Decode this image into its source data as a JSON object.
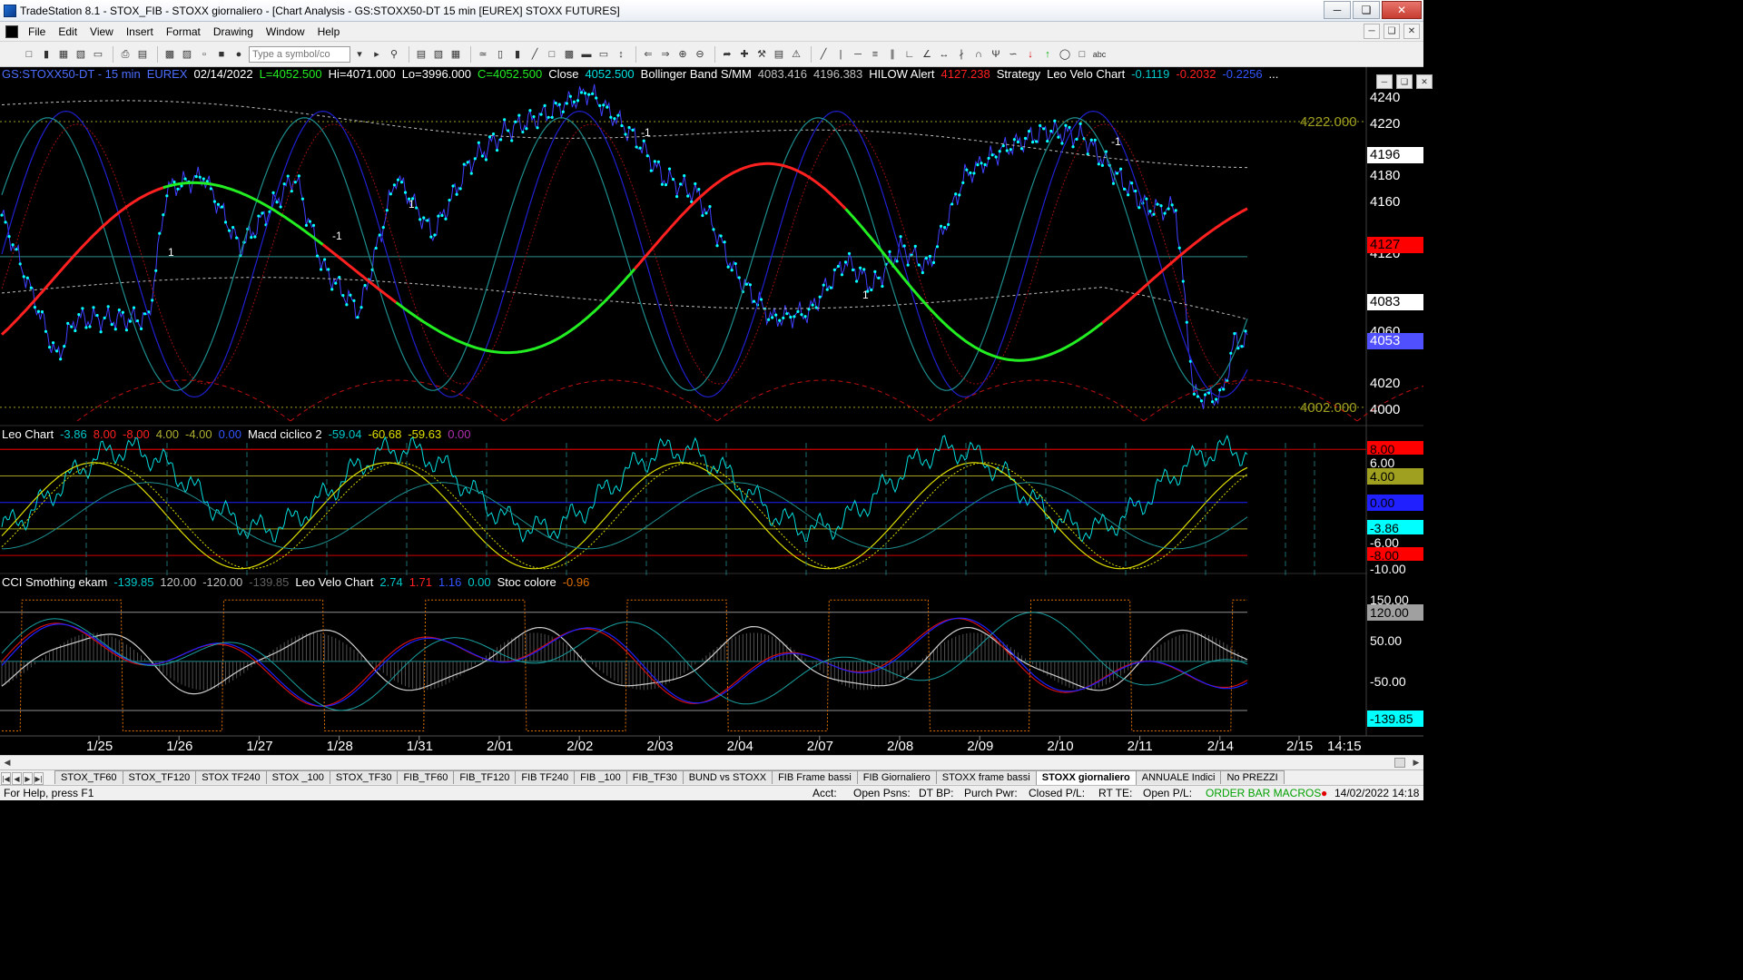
{
  "window": {
    "title": "TradeStation 8.1 - STOX_FIB - STOXX giornaliero - [Chart Analysis - GS:STOXX50-DT  15 min  [EUREX] STOXX FUTURES]",
    "buttons": [
      "─",
      "❏",
      "✕"
    ]
  },
  "menu": [
    "File",
    "Edit",
    "View",
    "Insert",
    "Format",
    "Drawing",
    "Window",
    "Help"
  ],
  "toolbar": {
    "symbol_placeholder": "Type a symbol/co"
  },
  "colors": {
    "background": "#000000",
    "cyan": "#00ffff",
    "red": "#ff0000",
    "green": "#22ee22",
    "yellow": "#dddd00",
    "blue": "#3333ff",
    "olive": "#a0a020"
  },
  "panes": {
    "price": {
      "header": [
        {
          "text": "GS:STOXX50-DT - 15 min",
          "color": "#4d6dff"
        },
        {
          "text": "EUREX",
          "color": "#4d6dff"
        },
        {
          "text": "02/14/2022",
          "color": "#ffffff"
        },
        {
          "text": "L=4052.500",
          "color": "#22ee22"
        },
        {
          "text": "Hi=4071.000",
          "color": "#ffffff"
        },
        {
          "text": "Lo=3996.000",
          "color": "#ffffff"
        },
        {
          "text": "C=4052.500",
          "color": "#22ee22"
        },
        {
          "text": "Close",
          "color": "#ffffff"
        },
        {
          "text": "4052.500",
          "color": "#00e0e0"
        },
        {
          "text": "Bollinger Band S/MM",
          "color": "#ffffff"
        },
        {
          "text": "4083.416",
          "color": "#c0c0c0"
        },
        {
          "text": "4196.383",
          "color": "#c0c0c0"
        },
        {
          "text": "HILOW Alert",
          "color": "#ffffff"
        },
        {
          "text": "4127.238",
          "color": "#ff2020"
        },
        {
          "text": "Strategy",
          "color": "#ffffff"
        },
        {
          "text": "Leo Velo Chart",
          "color": "#ffffff"
        },
        {
          "text": "-0.1119",
          "color": "#00c8c8"
        },
        {
          "text": "-0.2032",
          "color": "#ff2020"
        },
        {
          "text": "-0.2256",
          "color": "#3355ff"
        },
        {
          "text": "...",
          "color": "#ffffff"
        }
      ],
      "axis_ticks": [
        {
          "v": 4240,
          "label": "4240"
        },
        {
          "v": 4220,
          "label": "4220"
        },
        {
          "v": 4180,
          "label": "4180"
        },
        {
          "v": 4160,
          "label": "4160"
        },
        {
          "v": 4120,
          "label": "4120"
        },
        {
          "v": 4060,
          "label": "4060"
        },
        {
          "v": 4020,
          "label": "4020"
        },
        {
          "v": 4000,
          "label": "4000"
        }
      ],
      "axis_badges": [
        {
          "v": 4196,
          "label": "4196",
          "bg": "#ffffff",
          "fg": "#000000"
        },
        {
          "v": 4127,
          "label": "4127",
          "bg": "#ff0000",
          "fg": "#000000"
        },
        {
          "v": 4083,
          "label": "4083",
          "bg": "#ffffff",
          "fg": "#000000"
        },
        {
          "v": 4053,
          "label": "4053",
          "bg": "#5050ff",
          "fg": "#ffffff"
        }
      ],
      "levels": [
        {
          "v": 4222,
          "label": "4222.000"
        },
        {
          "v": 4002,
          "label": "4002.000"
        }
      ],
      "markers": [
        "1",
        "-1"
      ]
    },
    "leo": {
      "header": [
        {
          "text": "Leo Chart",
          "color": "#ffffff"
        },
        {
          "text": "-3.86",
          "color": "#00c8c8"
        },
        {
          "text": "8.00",
          "color": "#ff2020"
        },
        {
          "text": "-8.00",
          "color": "#ff2020"
        },
        {
          "text": "4.00",
          "color": "#b0b030"
        },
        {
          "text": "-4.00",
          "color": "#b0b030"
        },
        {
          "text": "0.00",
          "color": "#3355ff"
        },
        {
          "text": "Macd ciclico 2",
          "color": "#ffffff"
        },
        {
          "text": "-59.04",
          "color": "#00c8c8"
        },
        {
          "text": "-60.68",
          "color": "#e0e000"
        },
        {
          "text": "-59.63",
          "color": "#e0e000"
        },
        {
          "text": "0.00",
          "color": "#b030b0"
        }
      ],
      "axis_badges": [
        {
          "v": 8,
          "label": "8.00",
          "bg": "#ff0000",
          "fg": "#000000"
        },
        {
          "v": 6,
          "label": "6.00",
          "bg": "#000000",
          "fg": "#ffffff"
        },
        {
          "v": 4,
          "label": "4.00",
          "bg": "#a0a020",
          "fg": "#000000"
        },
        {
          "v": 0,
          "label": "0.00",
          "bg": "#2020ff",
          "fg": "#000000"
        },
        {
          "v": -3.86,
          "label": "-3.86",
          "bg": "#00ffff",
          "fg": "#000000"
        },
        {
          "v": -6,
          "label": "-6.00",
          "bg": "#000000",
          "fg": "#ffffff"
        },
        {
          "v": -8,
          "label": "-8.00",
          "bg": "#ff0000",
          "fg": "#000000"
        },
        {
          "v": -10,
          "label": "-10.00",
          "bg": "#000000",
          "fg": "#ffffff"
        }
      ]
    },
    "cci": {
      "header": [
        {
          "text": "CCI Smothing ekam",
          "color": "#ffffff"
        },
        {
          "text": "-139.85",
          "color": "#00c8c8"
        },
        {
          "text": "120.00",
          "color": "#c0c0c0"
        },
        {
          "text": "-120.00",
          "color": "#c0c0c0"
        },
        {
          "text": "-139.85",
          "color": "#606060"
        },
        {
          "text": "Leo Velo Chart",
          "color": "#ffffff"
        },
        {
          "text": "2.74",
          "color": "#00c8c8"
        },
        {
          "text": "1.71",
          "color": "#ff2020"
        },
        {
          "text": "1.16",
          "color": "#3355ff"
        },
        {
          "text": "0.00",
          "color": "#00c8c8"
        },
        {
          "text": "Stoc colore",
          "color": "#ffffff"
        },
        {
          "text": "-0.96",
          "color": "#e07000"
        }
      ],
      "axis_badges": [
        {
          "v": 150,
          "label": "150.00",
          "bg": "#000000",
          "fg": "#ffffff"
        },
        {
          "v": 120,
          "label": "120.00",
          "bg": "#a0a0a0",
          "fg": "#000000"
        },
        {
          "v": 50,
          "label": "50.00",
          "bg": "#000000",
          "fg": "#ffffff"
        },
        {
          "v": -50,
          "label": "-50.00",
          "bg": "#000000",
          "fg": "#ffffff"
        },
        {
          "v": -139.85,
          "label": "-139.85",
          "bg": "#00ffff",
          "fg": "#000000"
        }
      ]
    }
  },
  "time_axis": [
    "1/25",
    "1/26",
    "1/27",
    "1/28",
    "1/31",
    "2/01",
    "2/02",
    "2/03",
    "2/04",
    "2/07",
    "2/08",
    "2/09",
    "2/10",
    "2/11",
    "2/14",
    "2/15",
    "14:15"
  ],
  "tabs": [
    "STOX_TF60",
    "STOX_TF120",
    "STOX TF240",
    "STOX _100",
    "STOX_TF30",
    "FIB_TF60",
    "FIB_TF120",
    "FIB TF240",
    "FIB _100",
    "FIB_TF30",
    "BUND vs STOXX",
    "FIB Frame bassi",
    "FIB Giornaliero",
    "STOXX frame bassi",
    "STOXX giornaliero",
    "ANNUALE Indici",
    "No PREZZI"
  ],
  "active_tab": "STOXX giornaliero",
  "status": {
    "help": "For Help, press F1",
    "acct": "Acct:",
    "open_psns": "Open Psns:",
    "dt_bp": "DT BP:",
    "purch_pwr": "Purch Pwr:",
    "closed_pl": "Closed P/L:",
    "rt_te": "RT TE:",
    "open_pl": "Open P/L:",
    "macros": "ORDER BAR  MACROS",
    "datetime": "14/02/2022 14:18"
  }
}
